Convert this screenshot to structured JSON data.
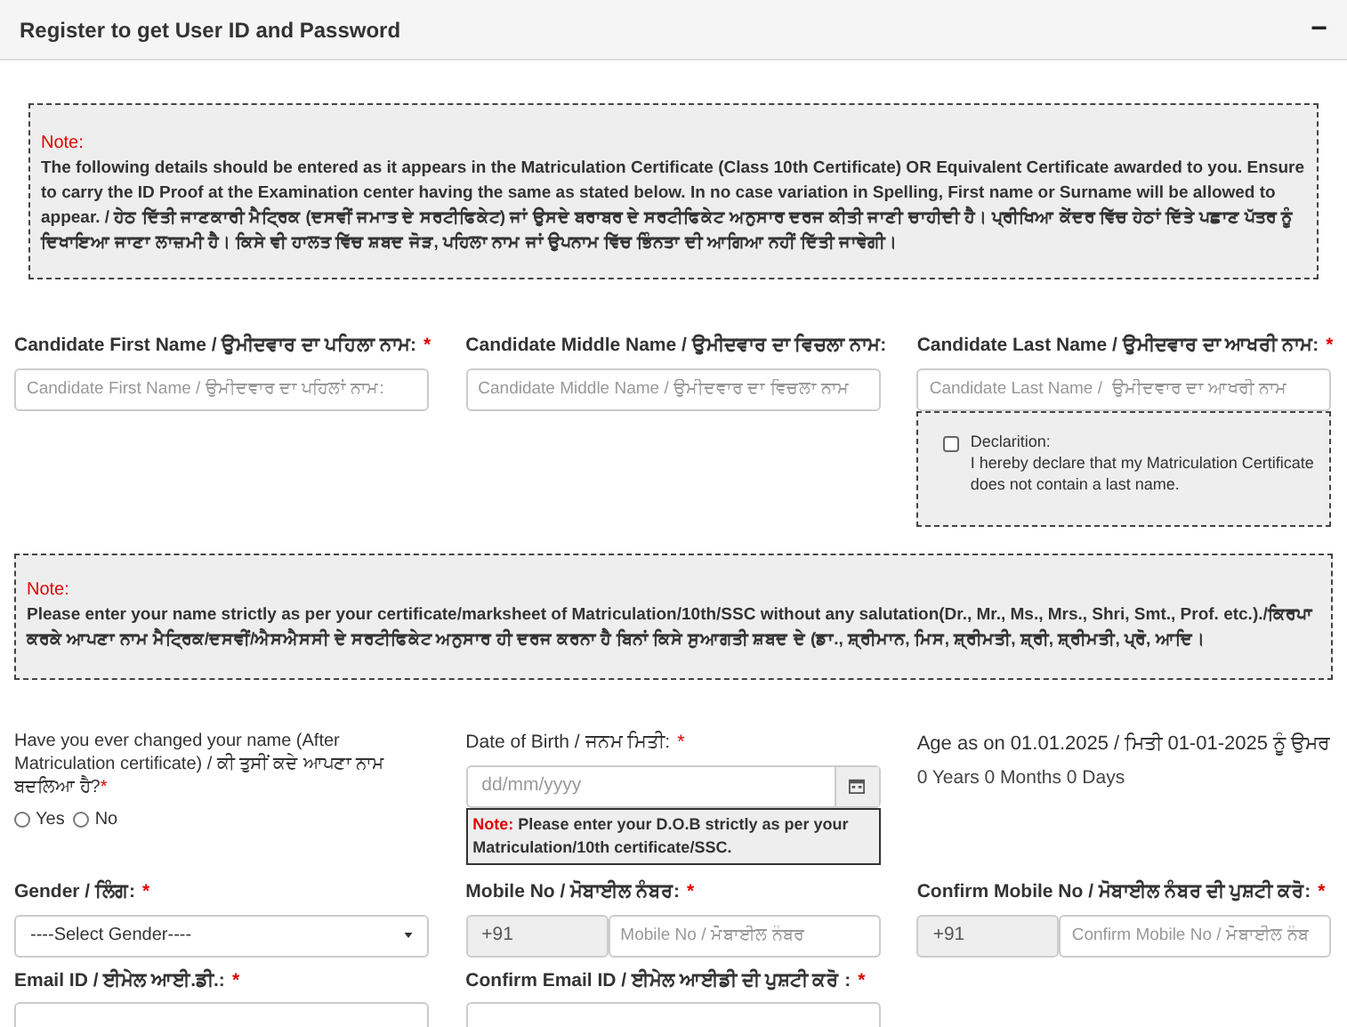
{
  "panel": {
    "title": "Register to get User ID and Password",
    "collapse_symbol": "−"
  },
  "note1": {
    "label": "Note:",
    "text": "The following details should be entered as it appears in the Matriculation Certificate (Class 10th Certificate) OR Equivalent Certificate awarded to you. Ensure to carry the ID Proof at the Examination center having the same as stated below. In no case variation in Spelling, First name or Surname will be allowed to appear. / ਹੇਠ ਦਿੱਤੀ ਜਾਣਕਾਰੀ ਮੈਟ੍ਰਿਕ (ਦਸਵੀਂ ਜਮਾਤ ਦੇ ਸਰਟੀਫਿਕੇਟ) ਜਾਂ ਉਸਦੇ ਬਰਾਬਰ ਦੇ ਸਰਟੀਫਿਕੇਟ ਅਨੁਸਾਰ ਦਰਜ ਕੀਤੀ ਜਾਣੀ ਚਾਹੀਦੀ ਹੈ। ਪ੍ਰੀਖਿਆ ਕੇਂਦਰ ਵਿੱਚ ਹੇਠਾਂ ਦਿੱਤੇ ਪਛਾਣ ਪੱਤਰ ਨੂੰ ਦਿਖਾਇਆ ਜਾਣਾ ਲਾਜ਼ਮੀ ਹੈ। ਕਿਸੇ ਵੀ ਹਾਲਤ ਵਿੱਚ ਸ਼ਬਦ ਜੋੜ, ਪਹਿਲਾ ਨਾਮ ਜਾਂ ਉਪਨਾਮ ਵਿੱਚ ਭਿੰਨਤਾ ਦੀ ਆਗਿਆ ਨਹੀਂ ਦਿੱਤੀ ਜਾਵੇਗੀ।"
  },
  "name_fields": [
    {
      "label": "Candidate First Name / ਉਮੀਦਵਾਰ ਦਾ ਪਹਿਲਾ ਨਾਮ:",
      "required_mark": "*",
      "placeholder": "Candidate First Name / ਉਮੀਦਵਾਰ ਦਾ ਪਹਿਲਾਂ ਨਾਮ:"
    },
    {
      "label": "Candidate Middle Name / ਉਮੀਦਵਾਰ ਦਾ ਵਿਚਲਾ ਨਾਮ:",
      "placeholder": "Candidate Middle Name / ਉਮੀਦਵਾਰ ਦਾ ਵਿਚਲਾ ਨਾਮ"
    },
    {
      "label": "Candidate Last Name / ਉਮੀਦਵਾਰ ਦਾ ਆਖਰੀ ਨਾਮ:",
      "required_mark": "*",
      "placeholder": "Candidate Last Name /  ਉਮੀਦਵਾਰ ਦਾ ਆਖਰੀ ਨਾਮ"
    }
  ],
  "declaration": {
    "checked": false,
    "title": "Declarition:",
    "text": "I hereby declare that my Matriculation Certificate does not contain a last name."
  },
  "note2": {
    "label": "Note:",
    "text": "Please enter your name strictly as per your certificate/marksheet of Matriculation/10th/SSC without any salutation(Dr., Mr., Ms., Mrs., Shri, Smt., Prof. etc.)./ਕਿਰਪਾ ਕਰਕੇ ਆਪਣਾ ਨਾਮ ਮੈਟ੍ਰਿਕ/ਦਸਵੀਂ/ਐਸਐਸਸੀ ਦੇ ਸਰਟੀਫਿਕੇਟ ਅਨੁਸਾਰ ਹੀ ਦਰਜ ਕਰਨਾ ਹੈ ਬਿਨਾਂ ਕਿਸੇ ਸੁਆਗਤੀ ਸ਼ਬਦ ਦੇ (ਡਾ., ਸ਼੍ਰੀਮਾਨ, ਮਿਸ, ਸ਼੍ਰੀਮਤੀ, ਸ਼੍ਰੀ, ਸ਼੍ਰੀਮਤੀ, ਪ੍ਰੋ, ਆਦਿ।"
  },
  "name_change": {
    "label": "Have you ever changed your name (After Matriculation certificate) / ਕੀ ਤੁਸੀਂ ਕਦੇ ਆਪਣਾ ਨਾਮ ਬਦਲਿਆ ਹੈ?",
    "required_mark": "*",
    "options": [
      {
        "label": "Yes",
        "selected": false
      },
      {
        "label": "No",
        "selected": false
      }
    ]
  },
  "dob": {
    "label": "Date of Birth / ਜਨਮ ਮਿਤੀ:",
    "required_mark": "*",
    "placeholder": "dd/mm/yyyy",
    "note_label": "Note:",
    "note_text": "Please enter your D.O.B strictly as per your Matriculation/10th certificate/SSC."
  },
  "age": {
    "label": "Age as on 01.01.2025 / ਮਿਤੀ 01-01-2025 ਨੂੰ ਉਮਰ",
    "value": "0 Years 0 Months 0 Days"
  },
  "gender": {
    "label": "Gender / ਲਿੰਗ:",
    "required_mark": "*",
    "value": "----Select Gender----"
  },
  "mobile": {
    "label": "Mobile No / ਮੋਬਾਈਲ ਨੰਬਰ:",
    "required_mark": "*",
    "prefix": "+91",
    "placeholder": "Mobile No / ਮੋਬਾਈਲ ਨੰਬਰ"
  },
  "confirm_mobile": {
    "label": "Confirm Mobile No / ਮੋਬਾਈਲ ਨੰਬਰ ਦੀ ਪੁਸ਼ਟੀ ਕਰੋ:",
    "required_mark": "*",
    "prefix": "+91",
    "placeholder": "Confirm Mobile No / ਮੋਬਾਈਲ ਨੰਬ"
  },
  "email": {
    "label": "Email ID / ਈਮੇਲ ਆਈ.ਡੀ.:",
    "required_mark": "*"
  },
  "confirm_email": {
    "label": "Confirm Email ID / ਈਮੇਲ ਆਈਡੀ ਦੀ ਪੁਸ਼ਟੀ ਕਰੋ :",
    "required_mark": "*"
  }
}
